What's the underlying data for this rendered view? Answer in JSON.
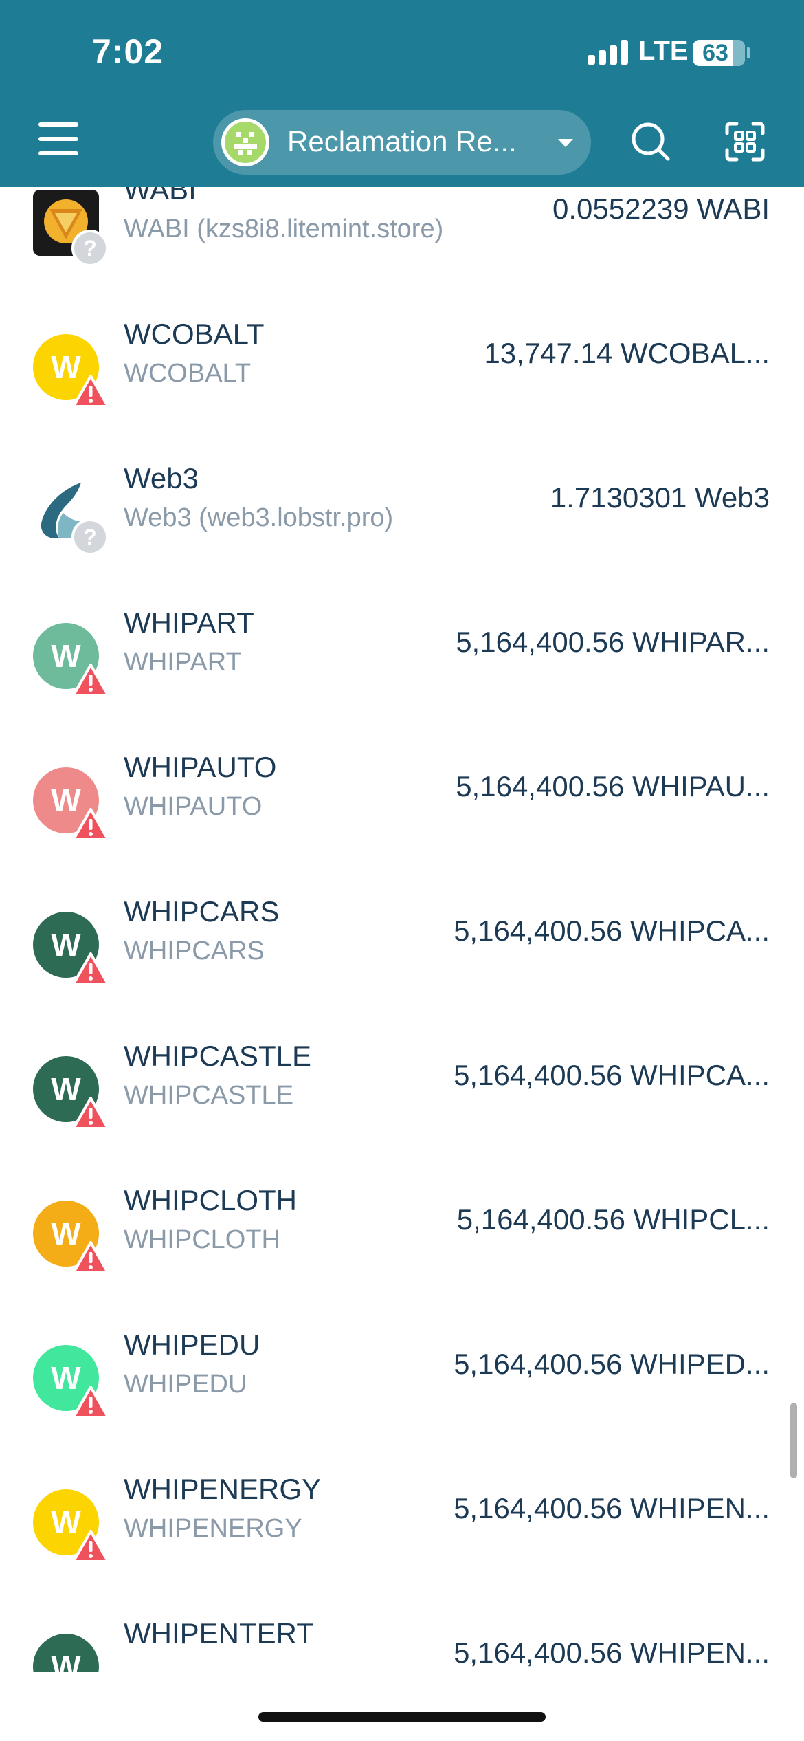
{
  "status_bar": {
    "time": "7:02",
    "network": "LTE",
    "battery": "63"
  },
  "header": {
    "account_name": "Reclamation Re..."
  },
  "colors": {
    "header_bg": "#1e7d95",
    "warning": "#f0525d"
  },
  "tokens": [
    {
      "code": "WABI",
      "issuer": "WABI (kzs8i8.litemint.store)",
      "balance": "0.0552239 WABI",
      "icon": "wabi-logo-icon",
      "badge": "question",
      "color": "#1a1a1a"
    },
    {
      "code": "WCOBALT",
      "issuer": "WCOBALT",
      "balance": "13,747.14 WCOBAL...",
      "icon": "letter-w-icon",
      "letter": "W",
      "badge": "warning",
      "color": "#fcd400"
    },
    {
      "code": "Web3",
      "issuer": "Web3 (web3.lobstr.pro)",
      "balance": "1.7130301 Web3",
      "icon": "web3-logo-icon",
      "badge": "question",
      "color": "#2b6a80"
    },
    {
      "code": "WHIPART",
      "issuer": "WHIPART",
      "balance": "5,164,400.56 WHIPAR...",
      "icon": "letter-w-icon",
      "letter": "W",
      "badge": "warning",
      "color": "#6dbb9a"
    },
    {
      "code": "WHIPAUTO",
      "issuer": "WHIPAUTO",
      "balance": "5,164,400.56 WHIPAU...",
      "icon": "letter-w-icon",
      "letter": "W",
      "badge": "warning",
      "color": "#ef8a8a"
    },
    {
      "code": "WHIPCARS",
      "issuer": "WHIPCARS",
      "balance": "5,164,400.56 WHIPCA...",
      "icon": "letter-w-icon",
      "letter": "W",
      "badge": "warning",
      "color": "#2e6b55"
    },
    {
      "code": "WHIPCASTLE",
      "issuer": "WHIPCASTLE",
      "balance": "5,164,400.56 WHIPCA...",
      "icon": "letter-w-icon",
      "letter": "W",
      "badge": "warning",
      "color": "#2e6b55"
    },
    {
      "code": "WHIPCLOTH",
      "issuer": "WHIPCLOTH",
      "balance": "5,164,400.56 WHIPCL...",
      "icon": "letter-w-icon",
      "letter": "W",
      "badge": "warning",
      "color": "#f5ad17"
    },
    {
      "code": "WHIPEDU",
      "issuer": "WHIPEDU",
      "balance": "5,164,400.56 WHIPED...",
      "icon": "letter-w-icon",
      "letter": "W",
      "badge": "warning",
      "color": "#41e79c"
    },
    {
      "code": "WHIPENERGY",
      "issuer": "WHIPENERGY",
      "balance": "5,164,400.56 WHIPEN...",
      "icon": "letter-w-icon",
      "letter": "W",
      "badge": "warning",
      "color": "#fcd400"
    },
    {
      "code": "WHIPENTERT",
      "issuer": "",
      "balance": "5,164,400.56 WHIPEN...",
      "icon": "letter-w-icon",
      "letter": "W",
      "badge": "warning",
      "color": "#2e6b55"
    }
  ]
}
